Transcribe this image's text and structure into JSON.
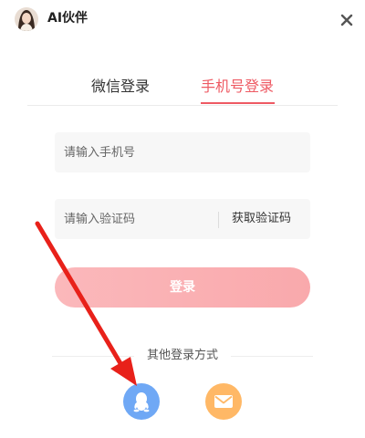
{
  "header": {
    "app_name": "AI伙伴",
    "avatar_icon": "user-avatar-icon",
    "close_icon": "close-icon"
  },
  "tabs": [
    {
      "label": "微信登录",
      "active": false
    },
    {
      "label": "手机号登录",
      "active": true
    }
  ],
  "form": {
    "phone_placeholder": "请输入手机号",
    "phone_value": "",
    "code_placeholder": "请输入验证码",
    "code_value": "",
    "get_code_label": "获取验证码",
    "login_label": "登录"
  },
  "other_login": {
    "title": "其他登录方式",
    "methods": [
      {
        "name": "qq",
        "icon": "qq-penguin-icon",
        "color": "#6fa8f5"
      },
      {
        "name": "email",
        "icon": "envelope-icon",
        "color": "#ffb866"
      }
    ]
  },
  "colors": {
    "accent": "#ee5a63",
    "login_button": "#f9a9ac",
    "annotation_arrow": "#e8211a"
  }
}
